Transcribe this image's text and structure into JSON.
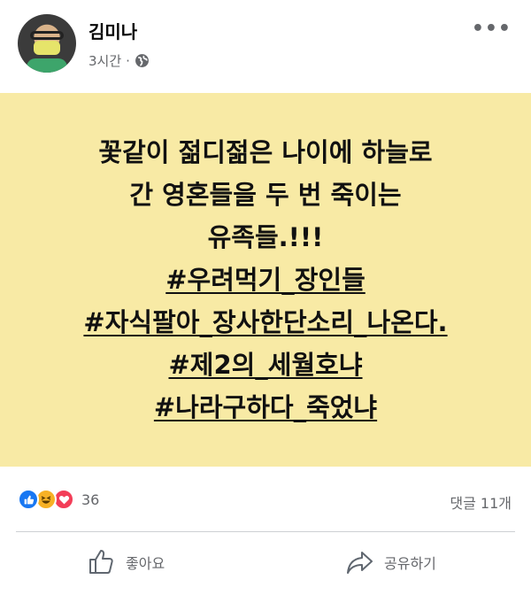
{
  "post": {
    "author": "김미나",
    "time": "3시간",
    "separator": "·",
    "privacy_icon": "globe-icon",
    "more_icon": "more-options-icon",
    "more_label": "•••"
  },
  "card": {
    "background": "#f8eaa5",
    "lines": [
      "꽃같이 젊디젊은 나이에 하늘로",
      "간 영혼들을 두 번 죽이는",
      "유족들.!!!"
    ],
    "hashtags": [
      "#우려먹기_장인들",
      "#자식팔아_장사한단소리_나온다.",
      "#제2의_세월호냐",
      "#나라구하다_죽었냐"
    ]
  },
  "stats": {
    "reaction_count": "36",
    "comments": "댓글 11개",
    "reactions": [
      "like-icon",
      "haha-icon",
      "love-icon"
    ]
  },
  "actions": {
    "like": "좋아요",
    "share": "공유하기"
  },
  "colors": {
    "like_blue": "#1877f2",
    "haha_yellow": "#f7b125",
    "love_red": "#f33e58",
    "meta_gray": "#65676b"
  }
}
